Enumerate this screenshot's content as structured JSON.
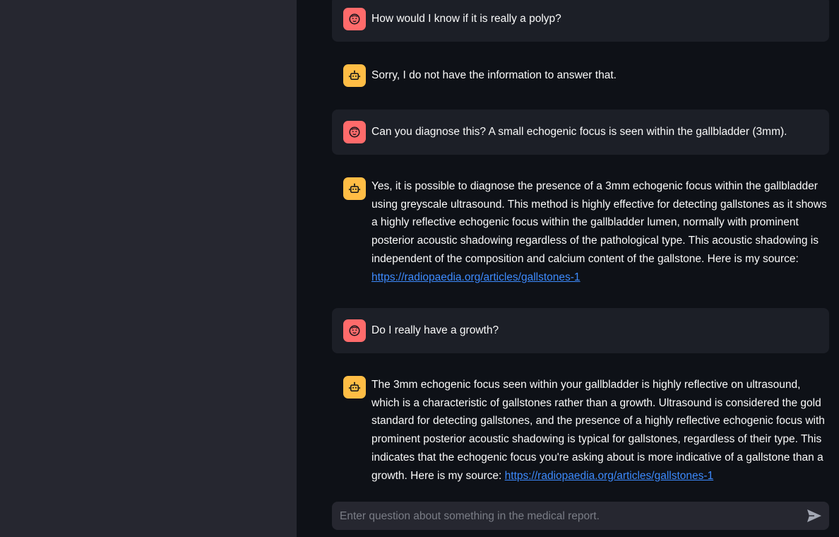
{
  "messages": [
    {
      "role": "user",
      "avatar_icon": "user-face-icon",
      "text": "How would I know if it is really a polyp?"
    },
    {
      "role": "assistant",
      "avatar_icon": "robot-icon",
      "text": "Sorry, I do not have the information to answer that."
    },
    {
      "role": "user",
      "avatar_icon": "user-face-icon",
      "text": "Can you diagnose this? A small echogenic focus is seen within the gallbladder (3mm)."
    },
    {
      "role": "assistant",
      "avatar_icon": "robot-icon",
      "text": "Yes, it is possible to diagnose the presence of a 3mm echogenic focus within the gallbladder using greyscale ultrasound. This method is highly effective for detecting gallstones as it shows a highly reflective echogenic focus within the gallbladder lumen, normally with prominent posterior acoustic shadowing regardless of the pathological type. This acoustic shadowing is independent of the composition and calcium content of the gallstone. Here is my source:",
      "link": "https://radiopaedia.org/articles/gallstones-1"
    },
    {
      "role": "user",
      "avatar_icon": "user-face-icon",
      "text": "Do I really have a growth?"
    },
    {
      "role": "assistant",
      "avatar_icon": "robot-icon",
      "text": "The 3mm echogenic focus seen within your gallbladder is highly reflective on ultrasound, which is a characteristic of gallstones rather than a growth. Ultrasound is considered the gold standard for detecting gallstones, and the presence of a highly reflective echogenic focus with prominent posterior acoustic shadowing is typical for gallstones, regardless of their type. This indicates that the echogenic focus you're asking about is more indicative of a gallstone than a growth. Here is my source:",
      "link": "https://radiopaedia.org/articles/gallstones-1"
    }
  ],
  "chat_input": {
    "placeholder": "Enter question about something in the medical report.",
    "value": "",
    "send_icon": "send-arrow-icon"
  },
  "colors": {
    "background": "#0e1117",
    "sidebar": "#262730",
    "user_bubble": "#1c1f27",
    "user_avatar": "#ff6b6b",
    "bot_avatar": "#ffbd45",
    "link": "#3d8bff"
  }
}
